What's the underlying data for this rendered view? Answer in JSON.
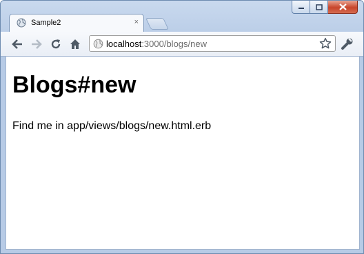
{
  "window": {
    "controls": {
      "minimize_icon": "minimize-icon",
      "maximize_icon": "maximize-icon",
      "close_icon": "close-icon"
    }
  },
  "tab": {
    "title": "Sample2",
    "favicon": "globe-icon",
    "close_glyph": "×"
  },
  "toolbar": {
    "back_icon": "back-arrow-icon",
    "forward_icon": "forward-arrow-icon",
    "reload_icon": "reload-icon",
    "home_icon": "home-icon",
    "bookmark_icon": "star-icon",
    "menu_icon": "wrench-icon"
  },
  "address_bar": {
    "host": "localhost",
    "rest": ":3000/blogs/new"
  },
  "page": {
    "heading": "Blogs#new",
    "paragraph": "Find me in app/views/blogs/new.html.erb"
  }
}
